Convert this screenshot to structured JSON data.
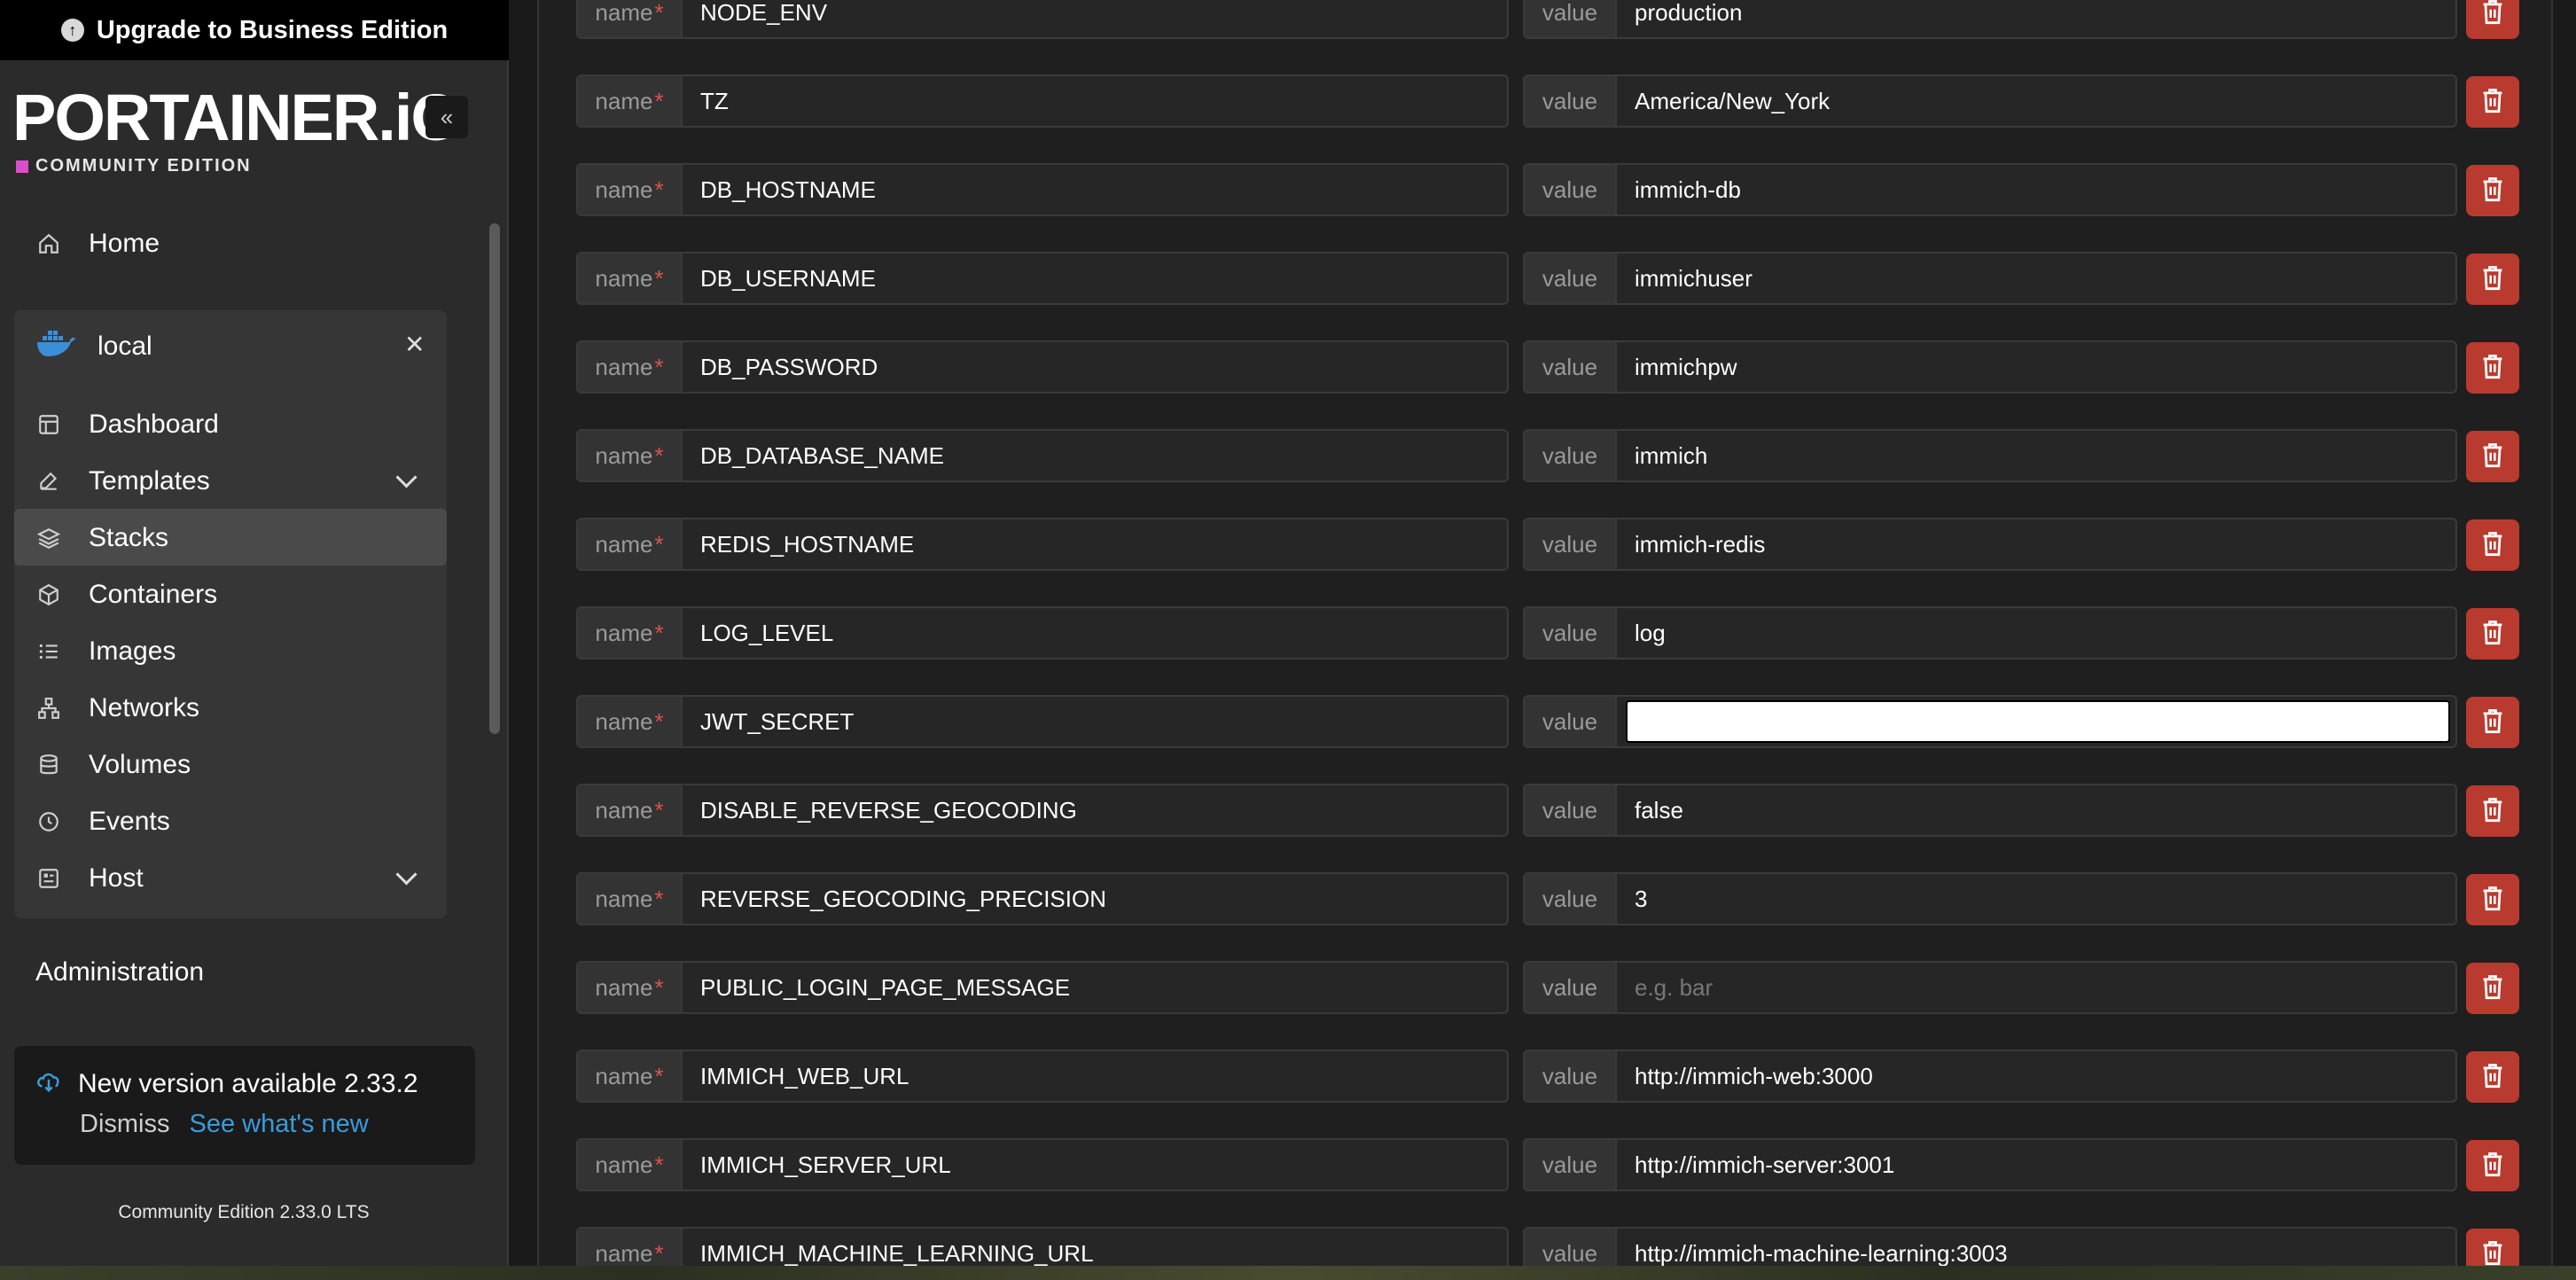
{
  "sidebar": {
    "upgrade_label": "Upgrade to Business Edition",
    "logo_text": "PORTAINER.iO",
    "logo_sub": "COMMUNITY EDITION",
    "home": "Home",
    "environment": "local",
    "env_items": {
      "dashboard": "Dashboard",
      "templates": "Templates",
      "stacks": "Stacks",
      "containers": "Containers",
      "images": "Images",
      "networks": "Networks",
      "volumes": "Volumes",
      "events": "Events",
      "host": "Host"
    },
    "administration": "Administration",
    "update": {
      "title": "New version available 2.33.2",
      "dismiss": "Dismiss",
      "whats_new": "See what's new"
    },
    "footer_version": "Community Edition  2.33.0 LTS"
  },
  "env_vars": {
    "name_label": "name",
    "required_mark": "*",
    "value_label": "value",
    "rows": [
      {
        "name": "NODE_ENV",
        "value": "production"
      },
      {
        "name": "TZ",
        "value": "America/New_York"
      },
      {
        "name": "DB_HOSTNAME",
        "value": "immich-db"
      },
      {
        "name": "DB_USERNAME",
        "value": "immichuser"
      },
      {
        "name": "DB_PASSWORD",
        "value": "immichpw"
      },
      {
        "name": "DB_DATABASE_NAME",
        "value": "immich"
      },
      {
        "name": "REDIS_HOSTNAME",
        "value": "immich-redis"
      },
      {
        "name": "LOG_LEVEL",
        "value": "log"
      },
      {
        "name": "JWT_SECRET",
        "value": ""
      },
      {
        "name": "DISABLE_REVERSE_GEOCODING",
        "value": "false"
      },
      {
        "name": "REVERSE_GEOCODING_PRECISION",
        "value": "3"
      },
      {
        "name": "PUBLIC_LOGIN_PAGE_MESSAGE",
        "value": "",
        "placeholder": "e.g. bar"
      },
      {
        "name": "IMMICH_WEB_URL",
        "value": "http://immich-web:3000"
      },
      {
        "name": "IMMICH_SERVER_URL",
        "value": "http://immich-server:3001"
      },
      {
        "name": "IMMICH_MACHINE_LEARNING_URL",
        "value": "http://immich-machine-learning:3003"
      }
    ]
  }
}
